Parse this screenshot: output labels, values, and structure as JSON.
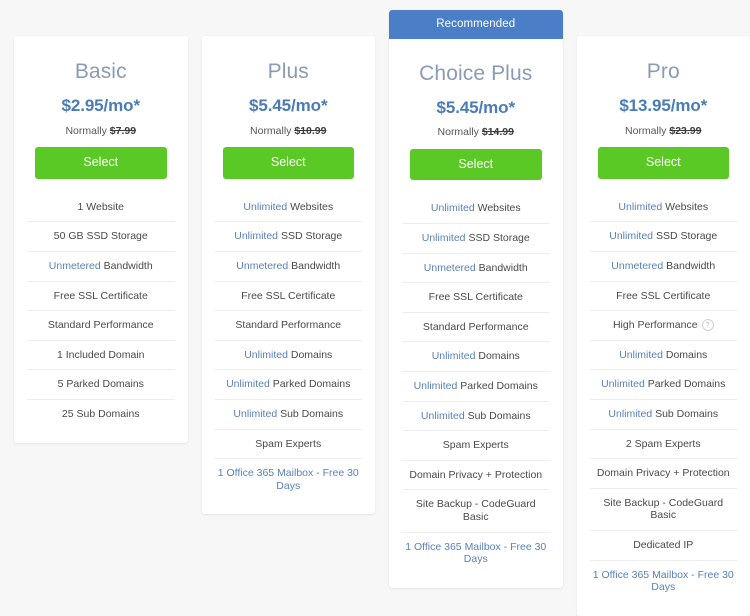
{
  "colors": {
    "page_background": "#f7f7f7",
    "card_background": "#ffffff",
    "ribbon_blue": "#4a7ec7",
    "select_green": "#5bc925",
    "title_gray_blue": "#8a9bb4",
    "price_blue": "#4a7cb5",
    "highlight_blue": "#5a81bb",
    "feature_text": "#4a4a4a",
    "divider": "#ededed"
  },
  "plans": [
    {
      "id": "basic",
      "name": "Basic",
      "price": "$2.95/mo*",
      "normally_label": "Normally",
      "normally_price": "$7.99",
      "select_label": "Select",
      "recommended": false,
      "ribbon_label": "",
      "features": [
        {
          "highlight": "",
          "text": "1 Website",
          "link": false,
          "info": false
        },
        {
          "highlight": "",
          "text": "50 GB SSD Storage",
          "link": false,
          "info": false
        },
        {
          "highlight": "Unmetered",
          "text": "Bandwidth",
          "link": false,
          "info": false
        },
        {
          "highlight": "",
          "text": "Free SSL Certificate",
          "link": false,
          "info": false
        },
        {
          "highlight": "",
          "text": "Standard Performance",
          "link": false,
          "info": false
        },
        {
          "highlight": "",
          "text": "1 Included Domain",
          "link": false,
          "info": false
        },
        {
          "highlight": "",
          "text": "5 Parked Domains",
          "link": false,
          "info": false
        },
        {
          "highlight": "",
          "text": "25 Sub Domains",
          "link": false,
          "info": false
        }
      ]
    },
    {
      "id": "plus",
      "name": "Plus",
      "price": "$5.45/mo*",
      "normally_label": "Normally",
      "normally_price": "$10.99",
      "select_label": "Select",
      "recommended": false,
      "ribbon_label": "",
      "features": [
        {
          "highlight": "Unlimited",
          "text": "Websites",
          "link": false,
          "info": false
        },
        {
          "highlight": "Unlimited",
          "text": "SSD Storage",
          "link": false,
          "info": false
        },
        {
          "highlight": "Unmetered",
          "text": "Bandwidth",
          "link": false,
          "info": false
        },
        {
          "highlight": "",
          "text": "Free SSL Certificate",
          "link": false,
          "info": false
        },
        {
          "highlight": "",
          "text": "Standard Performance",
          "link": false,
          "info": false
        },
        {
          "highlight": "Unlimited",
          "text": "Domains",
          "link": false,
          "info": false
        },
        {
          "highlight": "Unlimited",
          "text": "Parked Domains",
          "link": false,
          "info": false
        },
        {
          "highlight": "Unlimited",
          "text": "Sub Domains",
          "link": false,
          "info": false
        },
        {
          "highlight": "",
          "text": "Spam Experts",
          "link": false,
          "info": false
        },
        {
          "highlight": "",
          "text": "1 Office 365 Mailbox - Free 30 Days",
          "link": true,
          "info": false
        }
      ]
    },
    {
      "id": "choice-plus",
      "name": "Choice Plus",
      "price": "$5.45/mo*",
      "normally_label": "Normally",
      "normally_price": "$14.99",
      "select_label": "Select",
      "recommended": true,
      "ribbon_label": "Recommended",
      "features": [
        {
          "highlight": "Unlimited",
          "text": "Websites",
          "link": false,
          "info": false
        },
        {
          "highlight": "Unlimited",
          "text": "SSD Storage",
          "link": false,
          "info": false
        },
        {
          "highlight": "Unmetered",
          "text": "Bandwidth",
          "link": false,
          "info": false
        },
        {
          "highlight": "",
          "text": "Free SSL Certificate",
          "link": false,
          "info": false
        },
        {
          "highlight": "",
          "text": "Standard Performance",
          "link": false,
          "info": false
        },
        {
          "highlight": "Unlimited",
          "text": "Domains",
          "link": false,
          "info": false
        },
        {
          "highlight": "Unlimited",
          "text": "Parked Domains",
          "link": false,
          "info": false
        },
        {
          "highlight": "Unlimited",
          "text": "Sub Domains",
          "link": false,
          "info": false
        },
        {
          "highlight": "",
          "text": "Spam Experts",
          "link": false,
          "info": false
        },
        {
          "highlight": "",
          "text": "Domain Privacy + Protection",
          "link": false,
          "info": false
        },
        {
          "highlight": "",
          "text": "Site Backup - CodeGuard Basic",
          "link": false,
          "info": false
        },
        {
          "highlight": "",
          "text": "1 Office 365 Mailbox - Free 30 Days",
          "link": true,
          "info": false
        }
      ]
    },
    {
      "id": "pro",
      "name": "Pro",
      "price": "$13.95/mo*",
      "normally_label": "Normally",
      "normally_price": "$23.99",
      "select_label": "Select",
      "recommended": false,
      "ribbon_label": "",
      "features": [
        {
          "highlight": "Unlimited",
          "text": "Websites",
          "link": false,
          "info": false
        },
        {
          "highlight": "Unlimited",
          "text": "SSD Storage",
          "link": false,
          "info": false
        },
        {
          "highlight": "Unmetered",
          "text": "Bandwidth",
          "link": false,
          "info": false
        },
        {
          "highlight": "",
          "text": "Free SSL Certificate",
          "link": false,
          "info": false
        },
        {
          "highlight": "",
          "text": "High Performance",
          "link": false,
          "info": true,
          "info_glyph": "?"
        },
        {
          "highlight": "Unlimited",
          "text": "Domains",
          "link": false,
          "info": false
        },
        {
          "highlight": "Unlimited",
          "text": "Parked Domains",
          "link": false,
          "info": false
        },
        {
          "highlight": "Unlimited",
          "text": "Sub Domains",
          "link": false,
          "info": false
        },
        {
          "highlight": "",
          "text": "2 Spam Experts",
          "link": false,
          "info": false
        },
        {
          "highlight": "",
          "text": "Domain Privacy + Protection",
          "link": false,
          "info": false
        },
        {
          "highlight": "",
          "text": "Site Backup - CodeGuard Basic",
          "link": false,
          "info": false
        },
        {
          "highlight": "",
          "text": "Dedicated IP",
          "link": false,
          "info": false
        },
        {
          "highlight": "",
          "text": "1 Office 365 Mailbox - Free 30 Days",
          "link": true,
          "info": false
        }
      ]
    }
  ]
}
